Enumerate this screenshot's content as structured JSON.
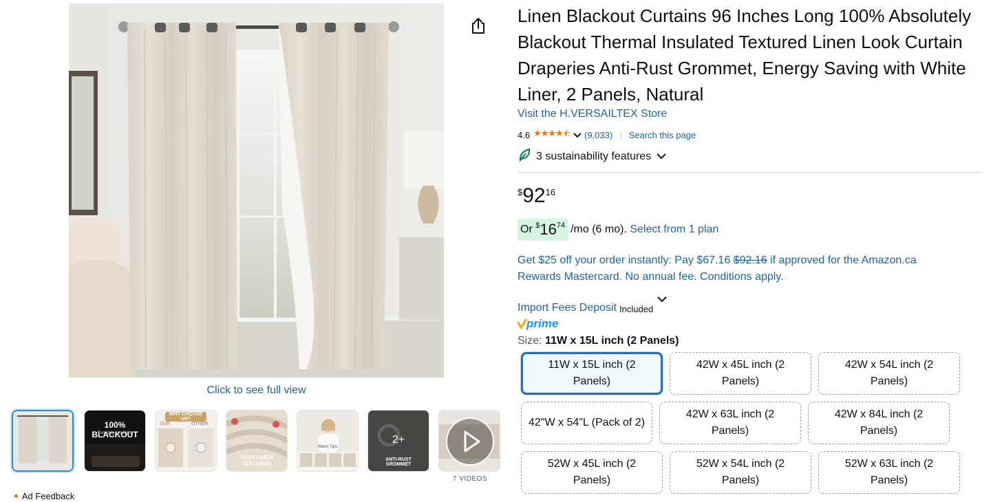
{
  "product": {
    "title": "Linen Blackout Curtains 96 Inches Long 100% Absolutely Blackout Thermal Insulated Textured Linen Look Curtain Draperies Anti-Rust Grommet, Energy Saving with White Liner, 2 Panels, Natural",
    "store_link": "Visit the H.VERSAILTEX Store"
  },
  "rating": {
    "value": "4.6",
    "stars": "★★★★⯪",
    "stars_fraction": 0.92,
    "count": "(9,033)",
    "search_link": "Search this page"
  },
  "sustainability": {
    "label": "3 sustainability features"
  },
  "price": {
    "symbol": "$",
    "whole": "92",
    "fraction": "16"
  },
  "monthly": {
    "prefix": "Or",
    "symbol": "$",
    "whole": "16",
    "fraction": "74",
    "suffix": "/mo (6 mo).",
    "plan_link": "Select from 1 plan"
  },
  "promo": {
    "part1": "Get $25 off your order instantly: Pay $67.16",
    "strike": "$92.16",
    "part2": "if approved for the Amazon.ca Rewards Mastercard. No annual fee. Conditions apply."
  },
  "import": {
    "link": "Import Fees Deposit",
    "included": "Included"
  },
  "prime": {
    "label": "prime"
  },
  "size": {
    "label": "Size:",
    "selected": "11W x 15L inch (2 Panels)",
    "options": [
      "11W x 15L inch (2 Panels)",
      "42W x 45L inch (2 Panels)",
      "42W x 54L inch (2 Panels)",
      "42\"W x 54\"L (Pack of 2)",
      "42W x 63L inch (2 Panels)",
      "42W x 84L inch (2 Panels)",
      "52W x 45L inch (2 Panels)",
      "52W x 54L inch (2 Panels)",
      "52W x 63L inch (2 Panels)"
    ]
  },
  "gallery": {
    "click_full_view": "Click to see full view",
    "thumb2_title": "100% BLACKOUT",
    "thumb2_sub": "Turn day into night",
    "thumb3_title": "WHY CHOOSE US?",
    "thumb3_our": "OUR",
    "thumb3_other": "OTHER",
    "thumb4_caption": "FAUX LINEN TEXTURED",
    "thumb5_title": "Warm Tips",
    "thumb6_more": "2+",
    "thumb6_caption": "ANTI-RUST GROMMET",
    "videos_label": "7 VIDEOS"
  },
  "ad_feedback": "Ad Feedback",
  "colors": {
    "link": "#2162a1",
    "rating_star": "#e77600",
    "price_highlight": "#d5f5e3",
    "selected_border": "#2a6db0",
    "prime_blue": "#1399ff",
    "prime_orange": "#f7a61b"
  }
}
